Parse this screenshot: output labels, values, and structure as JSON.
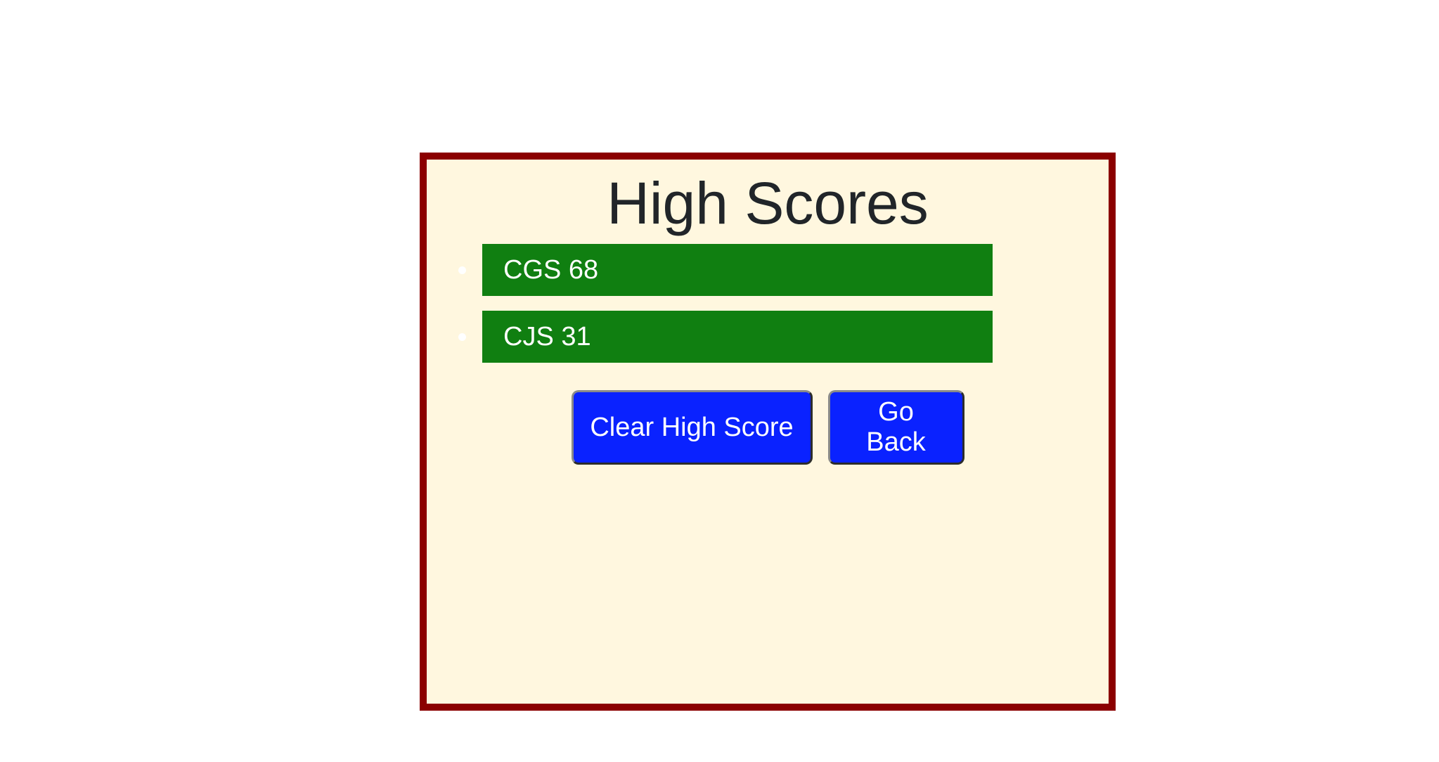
{
  "page": {
    "title": "High Scores"
  },
  "scores": [
    {
      "entry": "CGS 68"
    },
    {
      "entry": "CJS 31"
    }
  ],
  "buttons": {
    "clear_label": "Clear High Score",
    "back_label": "Go Back"
  },
  "colors": {
    "card_border": "#8b0000",
    "card_background": "#fff7df",
    "score_bar": "#107f11",
    "button": "#0a22ff"
  }
}
